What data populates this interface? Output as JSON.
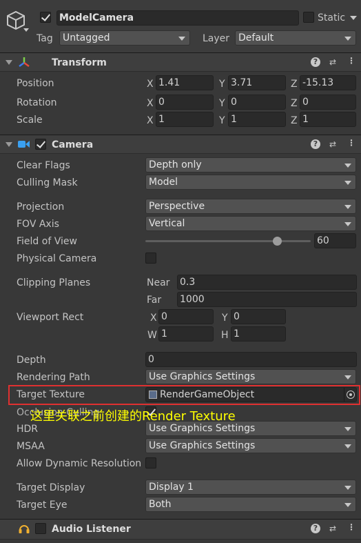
{
  "object": {
    "name": "ModelCamera",
    "static_label": "Static",
    "tag_label": "Tag",
    "tag_value": "Untagged",
    "layer_label": "Layer",
    "layer_value": "Default"
  },
  "transform": {
    "title": "Transform",
    "rows": [
      {
        "label": "Position",
        "x": "1.41",
        "y": "3.71",
        "z": "-15.13"
      },
      {
        "label": "Rotation",
        "x": "0",
        "y": "0",
        "z": "0"
      },
      {
        "label": "Scale",
        "x": "1",
        "y": "1",
        "z": "1"
      }
    ],
    "axis": {
      "x": "X",
      "y": "Y",
      "z": "Z"
    }
  },
  "camera": {
    "title": "Camera",
    "clear_flags": {
      "label": "Clear Flags",
      "value": "Depth only"
    },
    "culling_mask": {
      "label": "Culling Mask",
      "value": "Model"
    },
    "projection": {
      "label": "Projection",
      "value": "Perspective"
    },
    "fov_axis": {
      "label": "FOV Axis",
      "value": "Vertical"
    },
    "field_of_view": {
      "label": "Field of View",
      "value": "60"
    },
    "physical_camera": {
      "label": "Physical Camera"
    },
    "clipping": {
      "label": "Clipping Planes",
      "near_label": "Near",
      "near": "0.3",
      "far_label": "Far",
      "far": "1000"
    },
    "viewport": {
      "label": "Viewport Rect",
      "x_label": "X",
      "x": "0",
      "y_label": "Y",
      "y": "0",
      "w_label": "W",
      "w": "1",
      "h_label": "H",
      "h": "1"
    },
    "depth": {
      "label": "Depth",
      "value": "0"
    },
    "rendering_path": {
      "label": "Rendering Path",
      "value": "Use Graphics Settings"
    },
    "target_texture": {
      "label": "Target Texture",
      "value": "RenderGameObject"
    },
    "occlusion_culling": {
      "label": "Occlusion Culling"
    },
    "hdr": {
      "label": "HDR",
      "value": "Use Graphics Settings"
    },
    "msaa": {
      "label": "MSAA",
      "value": "Use Graphics Settings"
    },
    "dynamic_resolution": {
      "label": "Allow Dynamic Resolution"
    },
    "target_display": {
      "label": "Target Display",
      "value": "Display 1"
    },
    "target_eye": {
      "label": "Target Eye",
      "value": "Both"
    }
  },
  "annotation": {
    "text": "这里关联之前创建的Render Texture",
    "color": "#ffff00",
    "box_color": "#e03030"
  },
  "audio_listener": {
    "title": "Audio Listener"
  },
  "fov_slider": {
    "min": 1,
    "max": 179,
    "value": 60
  }
}
